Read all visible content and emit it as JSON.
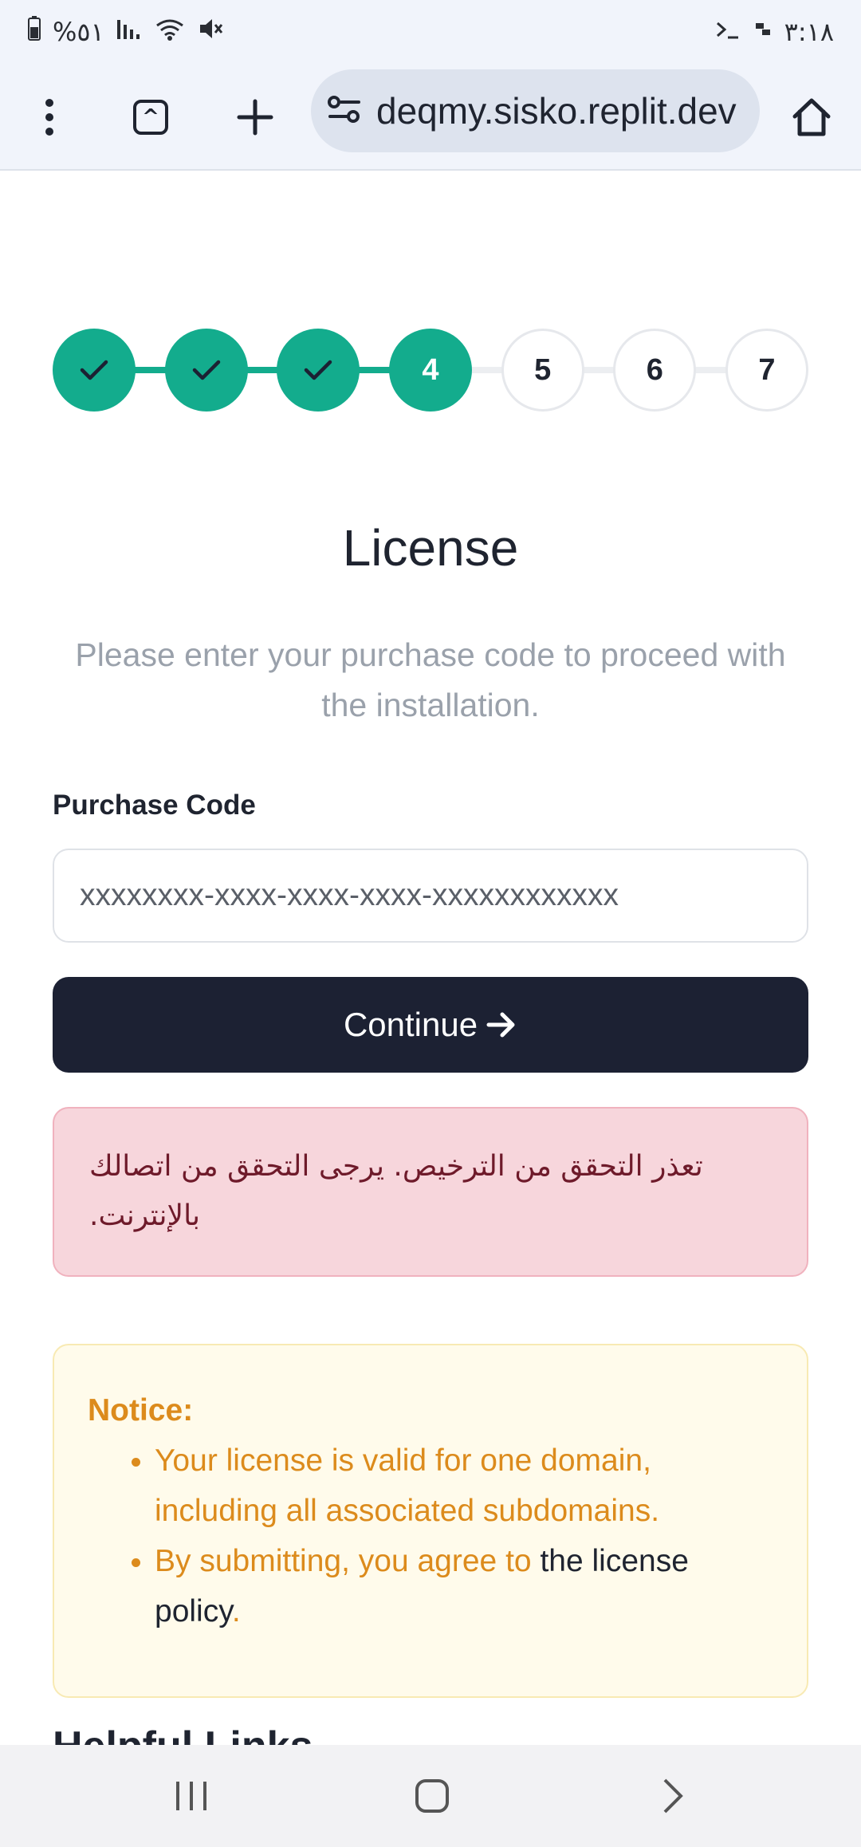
{
  "status_bar": {
    "battery_text": "%٥١",
    "time": "٣:١٨"
  },
  "browser": {
    "url": "deqmy.sisko.replit.dev",
    "tab_count": "^"
  },
  "steps": [
    {
      "label": "✓",
      "state": "done"
    },
    {
      "label": "✓",
      "state": "done"
    },
    {
      "label": "✓",
      "state": "done"
    },
    {
      "label": "4",
      "state": "active"
    },
    {
      "label": "5",
      "state": "pending"
    },
    {
      "label": "6",
      "state": "pending"
    },
    {
      "label": "7",
      "state": "pending"
    }
  ],
  "page": {
    "title": "License",
    "subtitle": "Please enter your purchase code to proceed with the installation."
  },
  "form": {
    "purchase_code_label": "Purchase Code",
    "purchase_code_placeholder": "xxxxxxxx-xxxx-xxxx-xxxx-xxxxxxxxxxxx",
    "purchase_code_value": "",
    "continue_label": "Continue"
  },
  "error": {
    "message": "تعذر التحقق من الترخيص. يرجى التحقق من اتصالك بالإنترنت."
  },
  "notice": {
    "title": "Notice:",
    "item1": "Your license is valid for one domain, including all associated subdomains.",
    "item2_prefix": "By submitting, you agree to",
    "item2_link": "the license policy",
    "item2_suffix": "."
  },
  "next_section": {
    "heading": "Helpful Links"
  },
  "colors": {
    "accent": "#13ac8d",
    "button": "#1c2133",
    "error_bg": "#f7d6dc",
    "notice_bg": "#fffbeb",
    "notice_text": "#dc8b1c"
  }
}
